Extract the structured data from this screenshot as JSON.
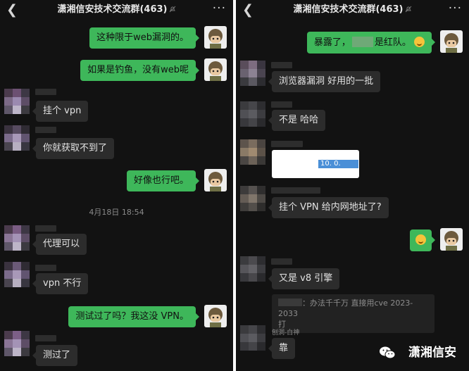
{
  "header": {
    "title": "潇湘信安技术交流群(463)",
    "back_icon": "chevron-left-icon",
    "more_label": "···"
  },
  "left": {
    "messages": [
      {
        "side": "right",
        "text": "这种限于web漏洞的。"
      },
      {
        "side": "right",
        "text": "如果是钓鱼，没有web呢"
      },
      {
        "side": "left",
        "text": "挂个 vpn"
      },
      {
        "side": "left",
        "text": "你就获取不到了"
      },
      {
        "side": "right",
        "text": "好像也行吧。"
      },
      {
        "side": "left",
        "text": "代理可以"
      },
      {
        "side": "left",
        "text": "vpn 不行"
      },
      {
        "side": "right",
        "text": "测试过了吗？我这没 VPN。"
      },
      {
        "side": "left",
        "text": "测过了"
      }
    ],
    "timestamp": "4月18日 18:54"
  },
  "right": {
    "first_message": {
      "before": "暴露了，",
      "after": "是红队。"
    },
    "messages": [
      {
        "side": "left",
        "text": "浏览器漏洞 好用的一批"
      },
      {
        "side": "left",
        "text": "不是 哈哈"
      },
      {
        "side": "left",
        "text": "挂个 VPN 给内网地址了?"
      },
      {
        "side": "left",
        "text": "又是 v8 引擎"
      },
      {
        "side": "left",
        "text": "靠"
      }
    ],
    "ip_selection": "10. 0.",
    "quote": {
      "line1": "：办法千千万 直接用cve 2023-2033",
      "line2": "打"
    },
    "sender": "刨洞-白神",
    "watermark": "潇湘信安"
  }
}
